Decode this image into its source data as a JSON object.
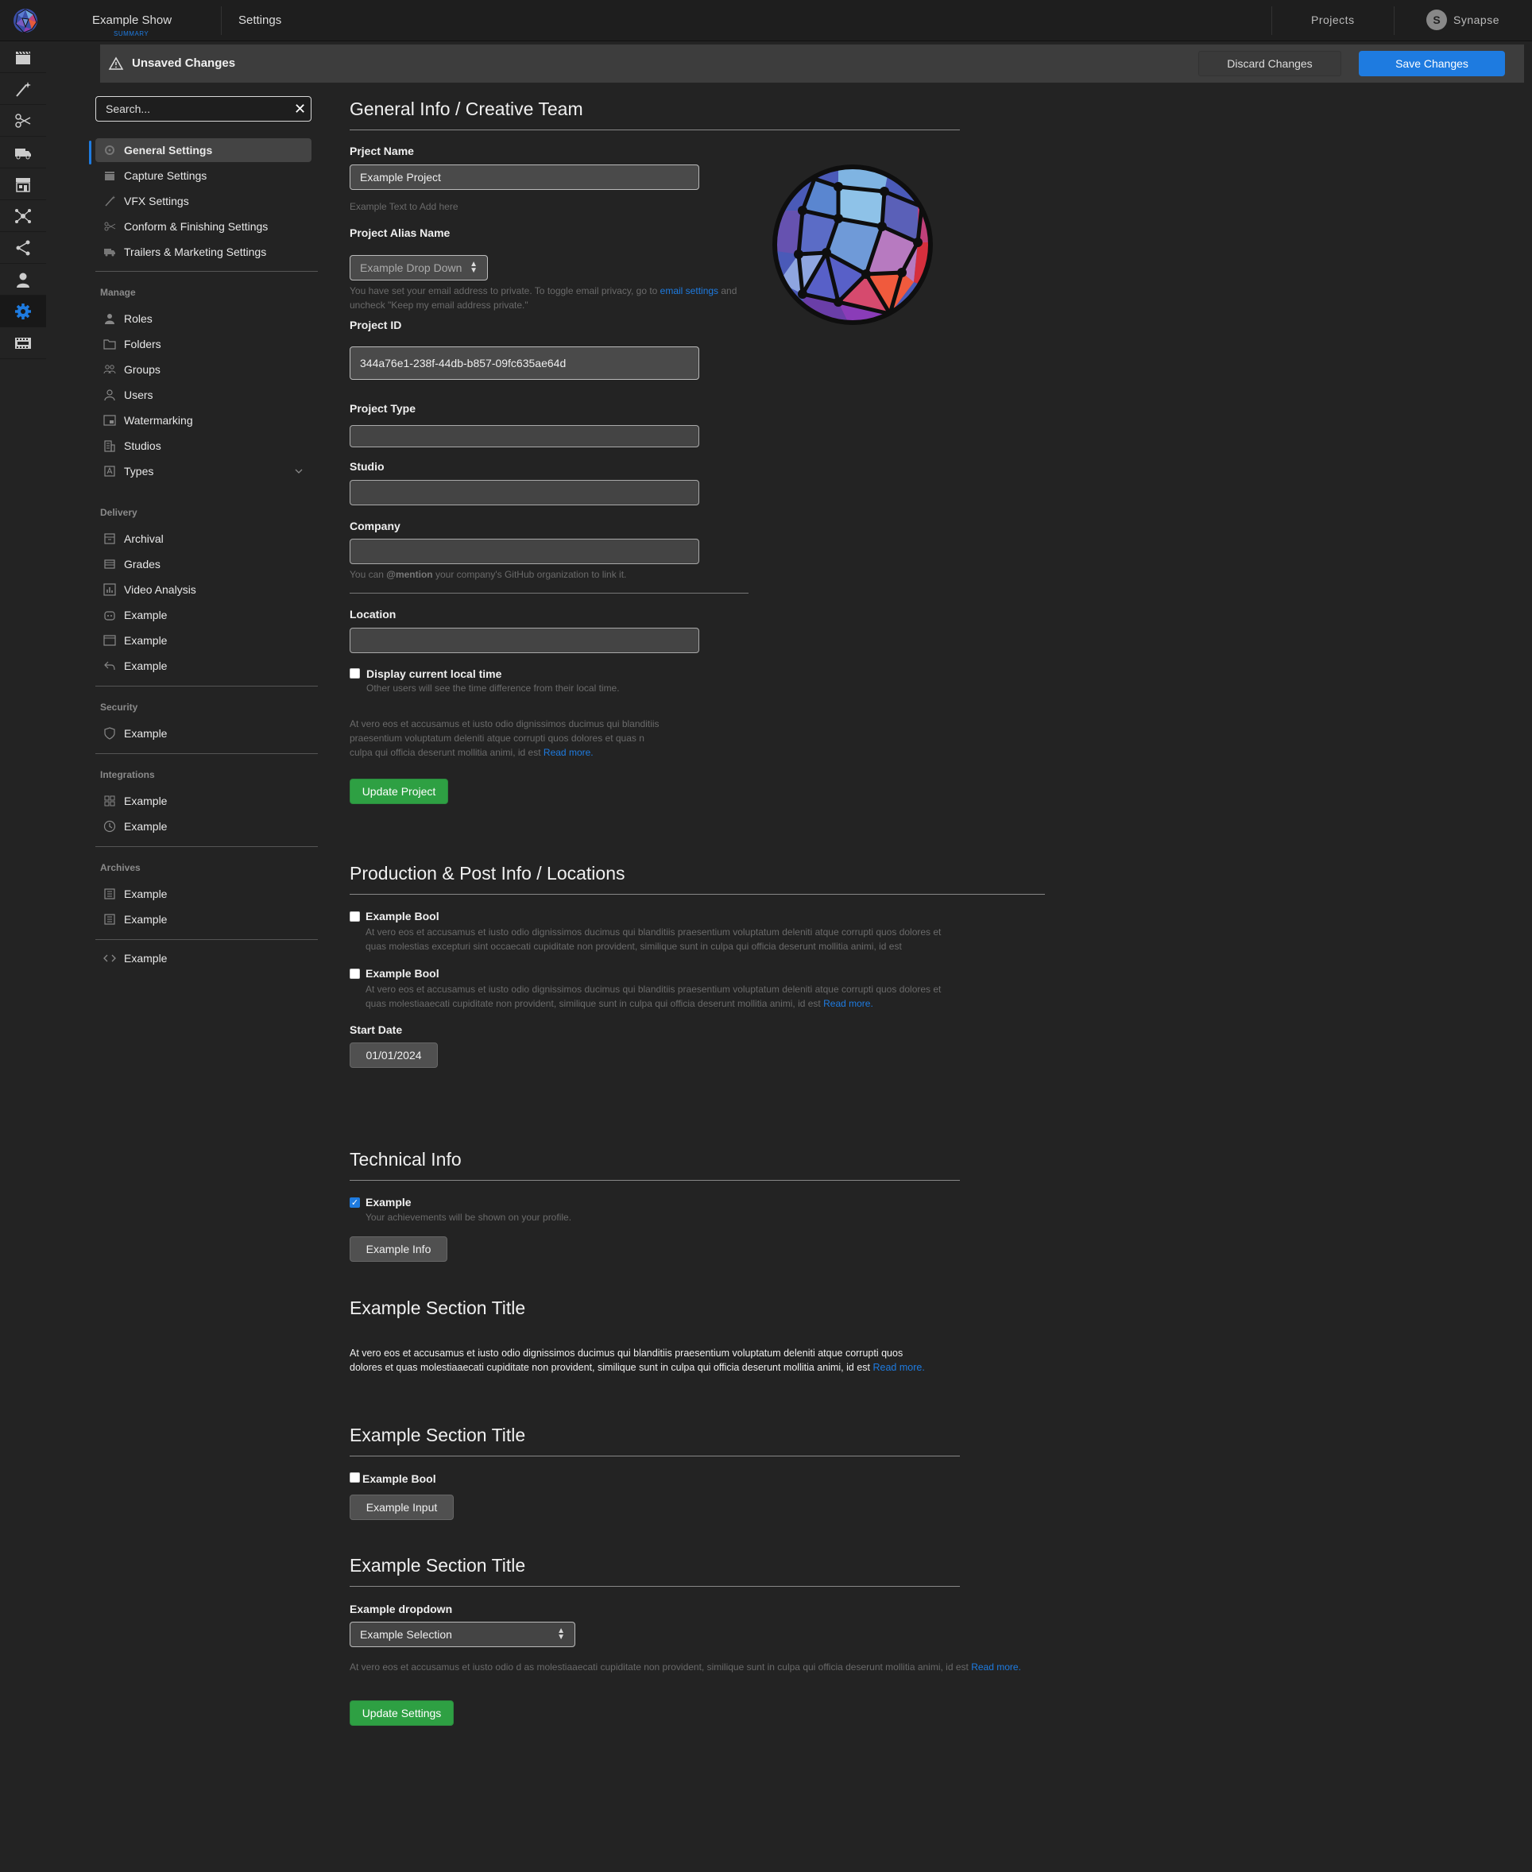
{
  "topbar": {
    "show_title": "Example Show",
    "show_subtitle": "SUMMARY",
    "settings_label": "Settings",
    "projects_label": "Projects",
    "user_initial": "S",
    "user_name": "Synapse"
  },
  "rail": {
    "icons": [
      "clapperboard-icon",
      "magic-wand-icon",
      "scissors-icon",
      "truck-icon",
      "storefront-icon",
      "network-icon",
      "share-icon",
      "person-icon",
      "gear-icon",
      "film-strip-icon"
    ],
    "active_index": 8
  },
  "unsaved_bar": {
    "title": "Unsaved Changes",
    "discard_label": "Discard Changes",
    "save_label": "Save Changes"
  },
  "sidebar": {
    "search_placeholder": "Search...",
    "general": [
      {
        "label": "General Settings",
        "icon": "gear-icon",
        "active": true
      },
      {
        "label": "Capture Settings",
        "icon": "clapperboard-icon"
      },
      {
        "label": "VFX Settings",
        "icon": "magic-wand-icon"
      },
      {
        "label": "Conform & Finishing Settings",
        "icon": "scissors-icon"
      },
      {
        "label": "Trailers & Marketing Settings",
        "icon": "truck-icon"
      }
    ],
    "manage_heading": "Manage",
    "manage": [
      {
        "label": "Roles",
        "icon": "person-icon"
      },
      {
        "label": "Folders",
        "icon": "folder-icon"
      },
      {
        "label": "Groups",
        "icon": "people-icon"
      },
      {
        "label": "Users",
        "icon": "user-icon"
      },
      {
        "label": "Watermarking",
        "icon": "picture-icon"
      },
      {
        "label": "Studios",
        "icon": "building-icon"
      },
      {
        "label": "Types",
        "icon": "tag-icon"
      }
    ],
    "delivery_heading": "Delivery",
    "delivery": [
      {
        "label": "Archival",
        "icon": "archive-icon"
      },
      {
        "label": "Grades",
        "icon": "stack-icon"
      },
      {
        "label": "Video Analysis",
        "icon": "graph-icon"
      },
      {
        "label": "Example",
        "icon": "copilot-icon"
      },
      {
        "label": "Example",
        "icon": "browser-icon"
      },
      {
        "label": "Example",
        "icon": "reply-icon"
      }
    ],
    "security_heading": "Security",
    "security": [
      {
        "label": "Example",
        "icon": "shield-icon"
      }
    ],
    "integrations_heading": "Integrations",
    "integrations": [
      {
        "label": "Example",
        "icon": "apps-icon"
      },
      {
        "label": "Example",
        "icon": "clock-icon"
      }
    ],
    "archives_heading": "Archives",
    "archives": [
      {
        "label": "Example",
        "icon": "log-icon"
      },
      {
        "label": "Example",
        "icon": "log-icon"
      }
    ],
    "footer": [
      {
        "label": "Example",
        "icon": "code-icon"
      }
    ]
  },
  "general_info": {
    "title": "General Info / Creative Team",
    "project_name_label": "Prject Name",
    "project_name_value": "Example Project",
    "project_name_hint": "Example Text to Add here",
    "alias_label": "Project Alias Name",
    "alias_value": "Example Drop Down",
    "alias_hint_before": "You have set your email address to private. To toggle email privacy, go to ",
    "alias_hint_link": "email settings",
    "alias_hint_after": " and uncheck \"Keep my email address private.\"",
    "project_id_label": "Project ID",
    "project_id_value": "344a76e1-238f-44db-b857-09fc635ae64d",
    "project_type_label": "Project Type",
    "project_type_value": "",
    "studio_label": "Studio",
    "studio_value": "",
    "company_label": "Company",
    "company_value": "",
    "company_hint_before": "You can ",
    "company_hint_mention": "@mention",
    "company_hint_after": " your company's GitHub organization to link it.",
    "location_label": "Location",
    "location_value": "",
    "local_time_label": "Display current local time",
    "local_time_checked": false,
    "local_time_hint": "Other users will see the time difference from their local time.",
    "paragraph": "At vero eos et accusamus et iusto odio dignissimos ducimus qui blanditiis praesentium voluptatum deleniti atque corrupti quos dolores et quas n culpa qui officia deserunt mollitia animi, id est",
    "read_more": "Read more.",
    "update_button": "Update Project"
  },
  "production": {
    "title": "Production & Post Info / Locations",
    "bool1_label": "Example Bool",
    "bool1_checked": false,
    "bool1_desc": "At vero eos et accusamus et iusto odio dignissimos ducimus qui blanditiis praesentium voluptatum deleniti atque corrupti quos dolores et quas molestias excepturi sint occaecati cupiditate non provident, similique sunt in culpa qui officia deserunt mollitia animi, id est",
    "bool2_label": "Example Bool",
    "bool2_checked": false,
    "bool2_desc": "At vero eos et accusamus et iusto odio dignissimos ducimus qui blanditiis praesentium voluptatum deleniti atque corrupti quos dolores et quas molestiaaecati cupiditate non provident, similique sunt in culpa qui officia deserunt mollitia animi, id est",
    "bool2_read_more": "Read more.",
    "start_date_label": "Start Date",
    "start_date_value": "01/01/2024"
  },
  "technical": {
    "title": "Technical Info",
    "check_label": "Example",
    "check_checked": true,
    "check_hint": "Your achievements will be shown on your profile.",
    "button": "Example Info"
  },
  "section_a": {
    "title": "Example Section Title",
    "paragraph": "At vero eos et accusamus et iusto odio dignissimos ducimus qui blanditiis praesentium voluptatum deleniti atque corrupti quos dolores et quas molestiaaecati cupiditate non provident, similique sunt in culpa qui officia deserunt mollitia animi, id est",
    "read_more": "Read more."
  },
  "section_b": {
    "title": "Example Section Title",
    "bool_label": "Example Bool",
    "bool_checked": false,
    "button": "Example Input"
  },
  "section_c": {
    "title": "Example Section Title",
    "dropdown_label": "Example dropdown",
    "dropdown_value": "Example Selection",
    "hint": "At vero eos et accusamus et iusto odio d as molestiaaecati cupiditate non provident, similique sunt in culpa qui officia deserunt mollitia animi, id est",
    "read_more": "Read more.",
    "update_button": "Update Settings"
  },
  "colors": {
    "accent": "#1e7be0",
    "success": "#2ea043",
    "background": "#232323"
  }
}
